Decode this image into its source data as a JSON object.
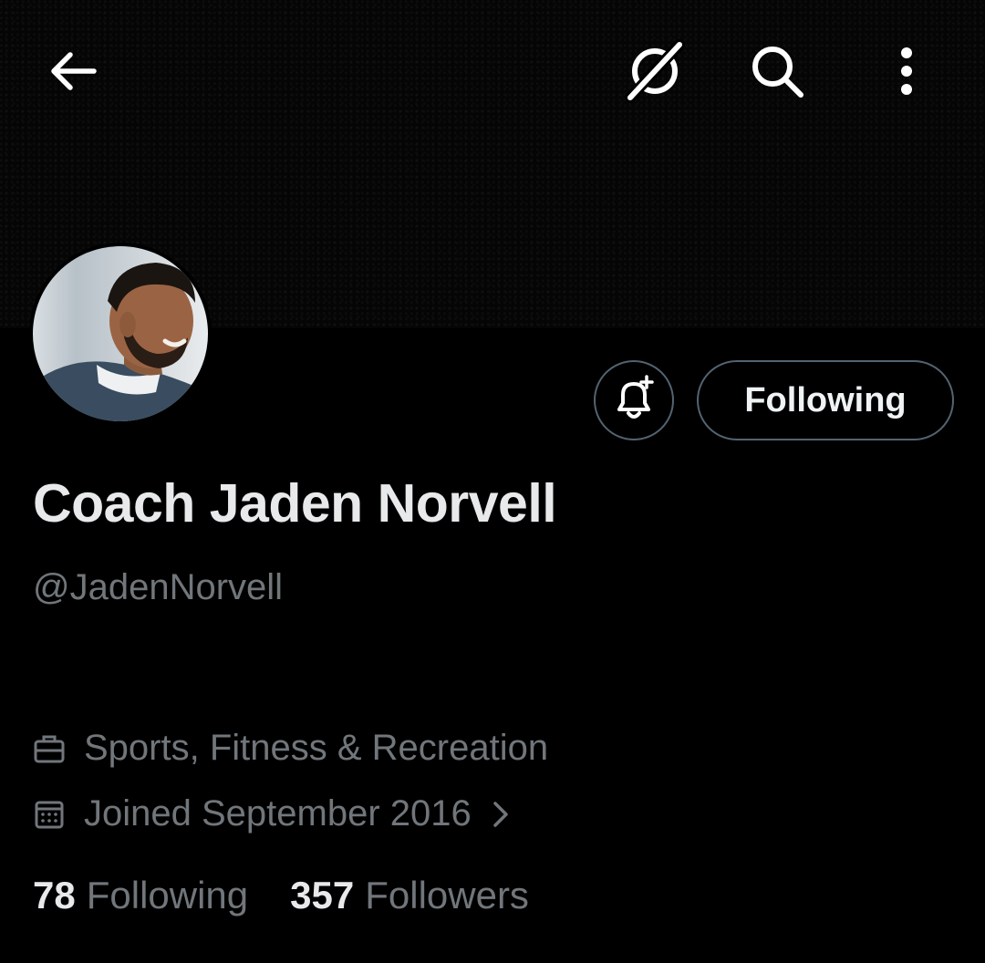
{
  "header": {
    "back_icon": "arrow-left-icon",
    "grok_icon": "grok-icon",
    "search_icon": "search-icon",
    "more_icon": "more-vertical-icon"
  },
  "profile": {
    "display_name": "Coach Jaden Norvell",
    "handle": "@JadenNorvell",
    "category": "Sports, Fitness & Recreation",
    "joined": "Joined September 2016"
  },
  "actions": {
    "notify_icon": "bell-plus-icon",
    "following_label": "Following"
  },
  "stats": {
    "following_count": "78",
    "following_label": "Following",
    "followers_count": "357",
    "followers_label": "Followers"
  },
  "colors": {
    "background": "#000000",
    "primary_text": "#e7e9ea",
    "secondary_text": "#71767b",
    "border": "#536471"
  }
}
